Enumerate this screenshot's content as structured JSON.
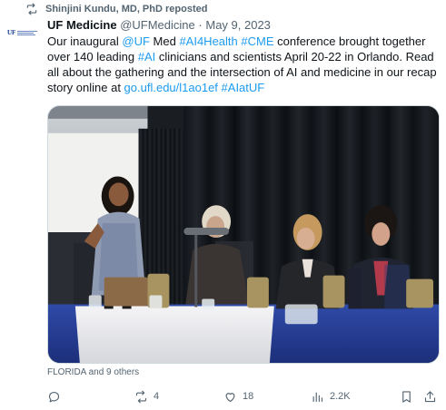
{
  "repost": {
    "text": "Shinjini Kundu, MD, PhD reposted",
    "icon": "repost-icon"
  },
  "tweet": {
    "display_name": "UF Medicine",
    "handle": "@UFMedicine",
    "separator": "·",
    "date": "May 9, 2023",
    "text_parts": [
      {
        "text": "Our inaugural ",
        "link": false
      },
      {
        "text": "@UF",
        "link": true
      },
      {
        "text": " Med ",
        "link": false
      },
      {
        "text": "#AI4Health",
        "link": true
      },
      {
        "text": " ",
        "link": false
      },
      {
        "text": "#CME",
        "link": true
      },
      {
        "text": " conference brought together over 140 leading ",
        "link": false
      },
      {
        "text": "#AI",
        "link": true
      },
      {
        "text": " clinicians and scientists April 20-22 in Orlando. Read all about the gathering and the intersection of AI and medicine in our recap story online at ",
        "link": false
      },
      {
        "text": "go.ufl.edu/l1ao1ef",
        "link": true
      },
      {
        "text": " ",
        "link": false
      },
      {
        "text": "#AIatUF",
        "link": true
      }
    ],
    "tagged": "FLORIDA and 9 others"
  },
  "avatar": {
    "text": "UF"
  },
  "actions": {
    "reply": {
      "icon": "reply-icon",
      "count": ""
    },
    "retweet": {
      "icon": "retweet-icon",
      "count": "4"
    },
    "like": {
      "icon": "heart-icon",
      "count": "18"
    },
    "views": {
      "icon": "views-icon",
      "count": "2.2K"
    },
    "bookmark": {
      "icon": "bookmark-icon"
    },
    "share": {
      "icon": "share-icon"
    }
  },
  "colors": {
    "link": "#1d9bf0",
    "secondary": "#536471",
    "text": "#0f1419"
  }
}
